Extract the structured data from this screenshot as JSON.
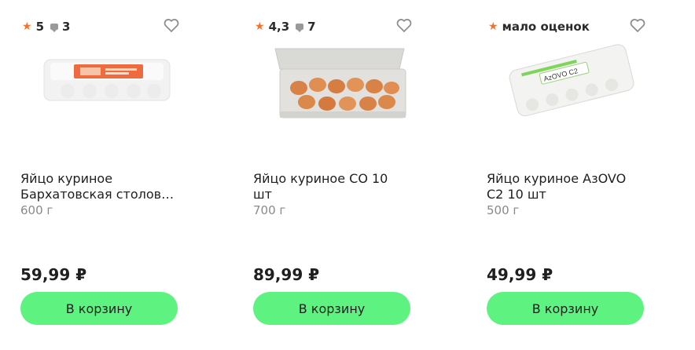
{
  "products": [
    {
      "rating": "5",
      "reviews": "3",
      "title_line1": "Яйцо куриное",
      "title_line2": "Бархатовская столов…",
      "weight": "600 г",
      "price": "59,99 ₽",
      "button": "В корзину"
    },
    {
      "rating": "4,3",
      "reviews": "7",
      "title_line1": "Яйцо куриное СО 10 шт",
      "title_line2": "",
      "weight": "700 г",
      "price": "89,99 ₽",
      "button": "В корзину"
    },
    {
      "rating_text": "мало оценок",
      "title_line1": "Яйцо куриное АзOVO",
      "title_line2": "С2 10 шт",
      "weight": "500 г",
      "price": "49,99 ₽",
      "button": "В корзину",
      "package_label": "AzOVO C2"
    }
  ],
  "colors": {
    "accent_button": "#5ef381",
    "star": "#f0742f"
  },
  "icons": [
    "star-icon",
    "comment-icon",
    "heart-icon"
  ]
}
